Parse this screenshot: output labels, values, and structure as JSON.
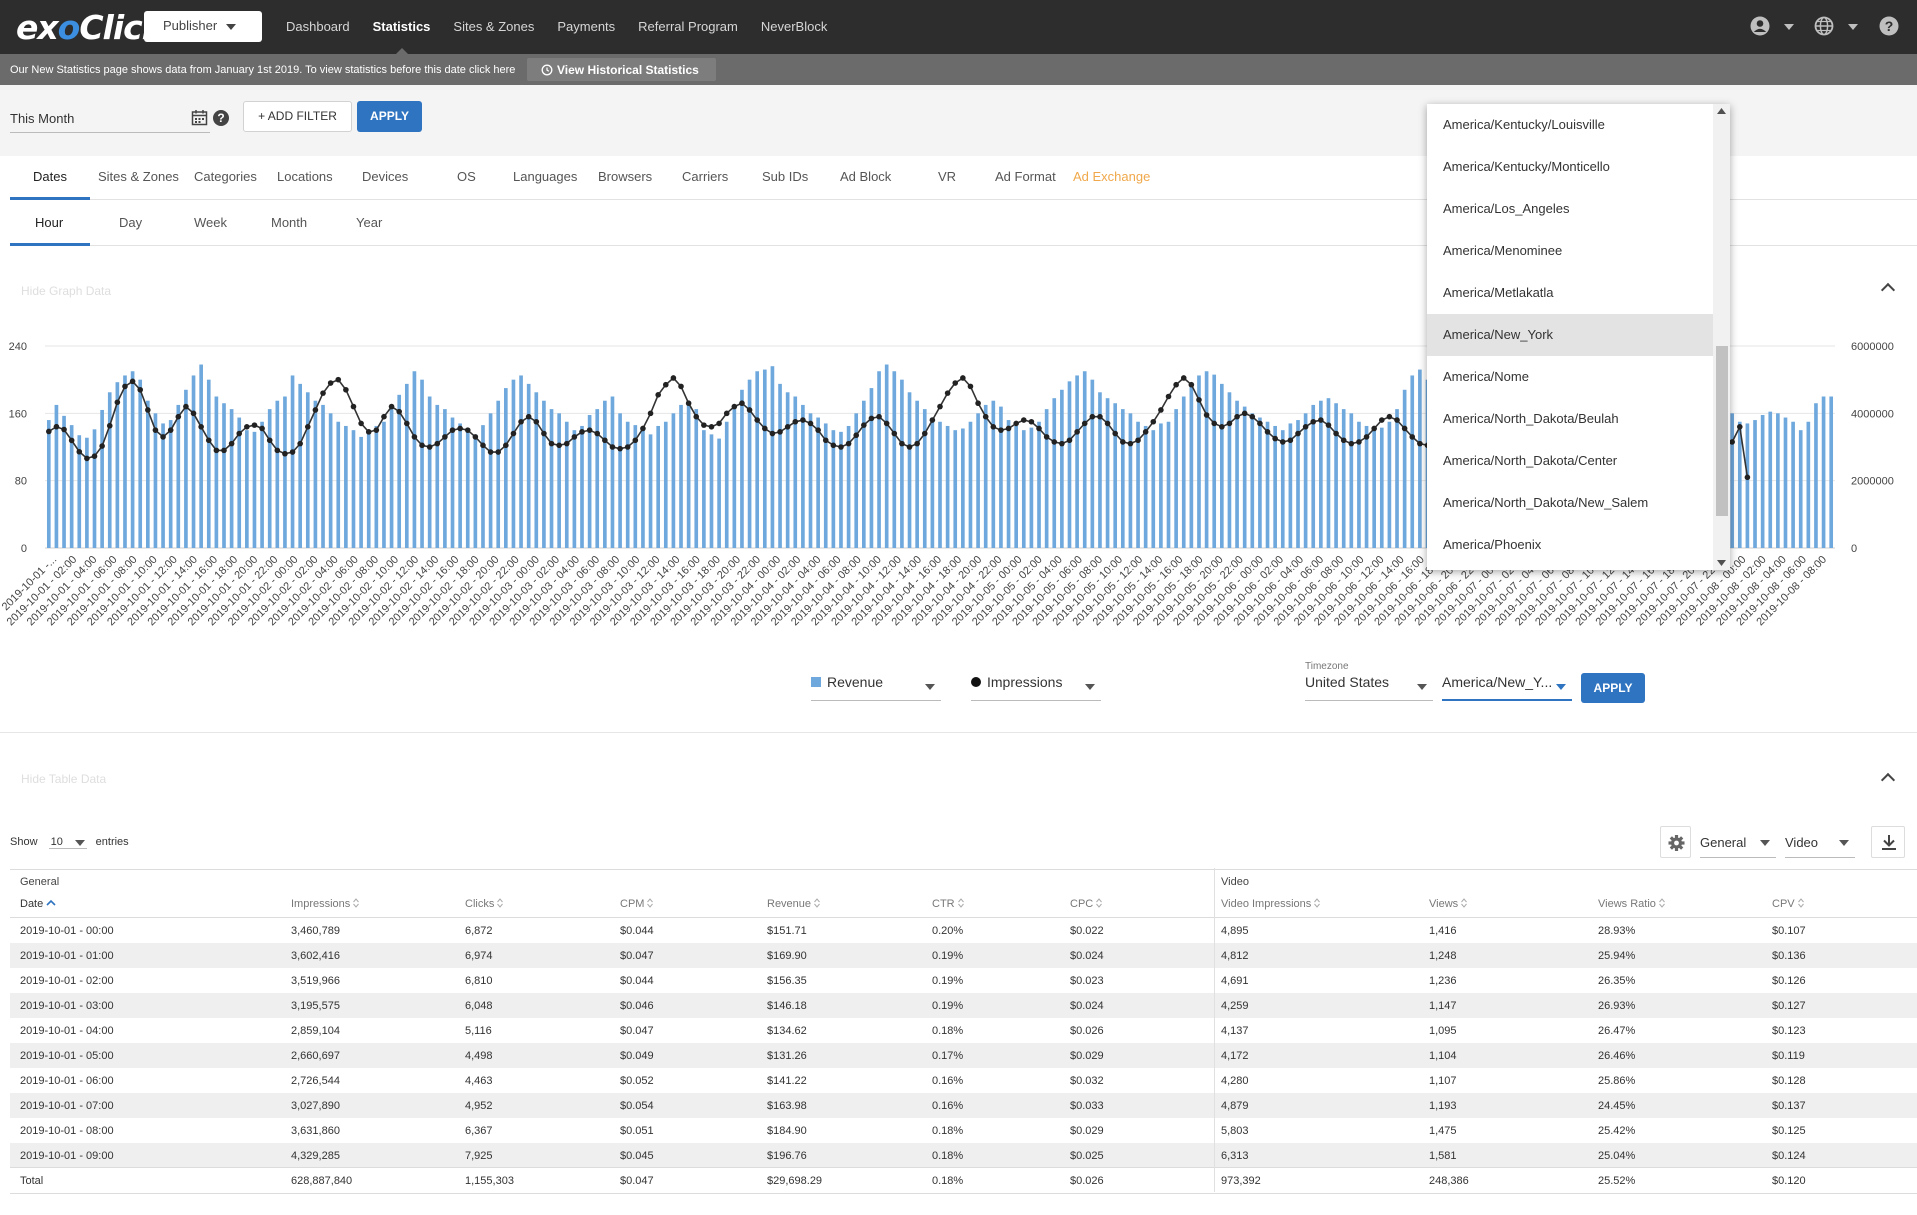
{
  "brand": {
    "logo_text_ex": "ex",
    "logo_text_o": "o",
    "logo_text_rest": "Click",
    "accent": "#2f74c0",
    "bar_color": "#6fa8dc"
  },
  "header": {
    "role_select": "Publisher",
    "nav": [
      "Dashboard",
      "Statistics",
      "Sites & Zones",
      "Payments",
      "Referral Program",
      "NeverBlock"
    ],
    "active_nav": "Statistics",
    "icons": [
      "account-icon",
      "globe-icon",
      "help-icon"
    ]
  },
  "notice": {
    "text": "Our New Statistics page shows data from January 1st 2019. To view statistics before this date click here",
    "button": "View Historical Statistics"
  },
  "filters": {
    "date_range": "This Month",
    "add_filter": "+ ADD FILTER",
    "apply": "APPLY"
  },
  "tabs": [
    "Dates",
    "Sites & Zones",
    "Categories",
    "Locations",
    "Devices",
    "OS",
    "Languages",
    "Browsers",
    "Carriers",
    "Sub IDs",
    "Ad Block",
    "VR",
    "Ad Format",
    "Ad Exchange"
  ],
  "active_tab": "Dates",
  "subtabs": [
    "Hour",
    "Day",
    "Week",
    "Month",
    "Year"
  ],
  "active_subtab": "Hour",
  "graph_toggle": "Hide Graph Data",
  "table_toggle": "Hide Table Data",
  "graph_controls": {
    "metric_left": "Revenue",
    "metric_right": "Impressions",
    "timezone_label": "Timezone",
    "country": "United States",
    "timezone": "America/New_Y...",
    "apply": "APPLY"
  },
  "timezone_dropdown": {
    "options": [
      "America/Kentucky/Louisville",
      "America/Kentucky/Monticello",
      "America/Los_Angeles",
      "America/Menominee",
      "America/Metlakatla",
      "America/New_York",
      "America/Nome",
      "America/North_Dakota/Beulah",
      "America/North_Dakota/Center",
      "America/North_Dakota/New_Salem",
      "America/Phoenix"
    ],
    "selected": "America/New_York"
  },
  "chart_data": {
    "type": "bar",
    "title": "",
    "y_left_ticks": [
      "240",
      "160",
      "80",
      "0"
    ],
    "y_right_ticks": [
      "6000000",
      "4000000",
      "2000000",
      "0"
    ],
    "ylim_left": [
      0,
      240
    ],
    "ylim_right": [
      0,
      6000000
    ],
    "x_tick_labels": [
      "2019-10-01 -...",
      "2019-10-01 - 02:00",
      "2019-10-01 - 04:00",
      "2019-10-01 - 06:00",
      "2019-10-01 - 08:00",
      "2019-10-01 - 10:00",
      "2019-10-01 - 12:00",
      "2019-10-01 - 14:00",
      "2019-10-01 - 16:00",
      "2019-10-01 - 18:00",
      "2019-10-01 - 20:00",
      "2019-10-01 - 22:00",
      "2019-10-02 - 00:00",
      "2019-10-02 - 02:00",
      "2019-10-02 - 04:00",
      "2019-10-02 - 06:00",
      "2019-10-02 - 08:00",
      "2019-10-02 - 10:00",
      "2019-10-02 - 12:00",
      "2019-10-02 - 14:00",
      "2019-10-02 - 16:00",
      "2019-10-02 - 18:00",
      "2019-10-02 - 20:00",
      "2019-10-02 - 22:00",
      "2019-10-03 - 00:00",
      "2019-10-03 - 02:00",
      "2019-10-03 - 04:00",
      "2019-10-03 - 06:00",
      "2019-10-03 - 08:00",
      "2019-10-03 - 10:00",
      "2019-10-03 - 12:00",
      "2019-10-03 - 14:00",
      "2019-10-03 - 16:00",
      "2019-10-03 - 18:00",
      "2019-10-03 - 20:00",
      "2019-10-03 - 22:00",
      "2019-10-04 - 00:00",
      "2019-10-04 - 02:00",
      "2019-10-04 - 04:00",
      "2019-10-04 - 06:00",
      "2019-10-04 - 08:00",
      "2019-10-04 - 10:00",
      "2019-10-04 - 12:00",
      "2019-10-04 - 14:00",
      "2019-10-04 - 16:00",
      "2019-10-04 - 18:00",
      "2019-10-04 - 20:00",
      "2019-10-04 - 22:00",
      "2019-10-05 - 00:00",
      "2019-10-05 - 02:00",
      "2019-10-05 - 04:00",
      "2019-10-05 - 06:00",
      "2019-10-05 - 08:00",
      "2019-10-05 - 10:00",
      "2019-10-05 - 12:00",
      "2019-10-05 - 14:00",
      "2019-10-05 - 16:00",
      "2019-10-05 - 18:00",
      "2019-10-05 - 20:00",
      "2019-10-05 - 22:00",
      "2019-10-06 - 00:00",
      "2019-10-06 - 02:00",
      "2019-10-06 - 04:00",
      "2019-10-06 - 06:00",
      "2019-10-06 - 08:00",
      "2019-10-06 - 10:00",
      "2019-10-06 - 12:00",
      "2019-10-06 - 14:00",
      "2019-10-06 - 16:00",
      "2019-10-06 - 18:00",
      "2019-10-06 - 20:00",
      "2019-10-06 - 22:00",
      "2019-10-07 - 00:00",
      "2019-10-07 - 02:00",
      "2019-10-07 - 04:00",
      "2019-10-07 - 06:00",
      "2019-10-07 - 08:00",
      "2019-10-07 - 10:00",
      "2019-10-07 - 12:00",
      "2019-10-07 - 14:00",
      "2019-10-07 - 16:00",
      "2019-10-07 - 18:00",
      "2019-10-07 - 20:00",
      "2019-10-07 - 22:00",
      "2019-10-08 - 00:00",
      "2019-10-08 - 02:00",
      "2019-10-08 - 04:00",
      "2019-10-08 - 06:00",
      "2019-10-08 - 08:00"
    ],
    "series": [
      {
        "name": "Revenue",
        "kind": "bar",
        "axis": "left",
        "color": "#6fa8dc",
        "values": [
          152,
          170,
          157,
          146,
          134,
          131,
          141,
          164,
          185,
          197,
          205,
          210,
          200,
          175,
          160,
          148,
          152,
          170,
          188,
          205,
          218,
          200,
          180,
          172,
          165,
          155,
          140,
          138,
          150,
          165,
          175,
          180,
          205,
          195,
          185,
          175,
          170,
          160,
          150,
          145,
          140,
          132,
          138,
          145,
          150,
          165,
          182,
          195,
          210,
          200,
          180,
          170,
          165,
          155,
          148,
          140,
          135,
          146,
          160,
          175,
          190,
          200,
          205,
          195,
          185,
          175,
          165,
          160,
          150,
          140,
          145,
          158,
          165,
          175,
          180,
          160,
          150,
          146,
          140,
          135,
          145,
          150,
          160,
          170,
          172,
          165,
          140,
          135,
          130,
          150,
          165,
          188,
          200,
          210,
          212,
          216,
          195,
          185,
          180,
          170,
          160,
          155,
          148,
          140,
          138,
          145,
          160,
          175,
          190,
          210,
          218,
          210,
          200,
          185,
          175,
          165,
          155,
          150,
          145,
          140,
          142,
          150,
          160,
          170,
          175,
          168,
          152,
          145,
          140,
          143,
          150,
          165,
          178,
          188,
          198,
          205,
          210,
          200,
          185,
          178,
          172,
          165,
          160,
          150,
          145,
          140,
          148,
          150,
          165,
          180,
          195,
          205,
          210,
          206,
          195,
          185,
          175,
          168,
          160,
          155,
          150,
          145,
          140,
          148,
          152,
          160,
          170,
          175,
          178,
          172,
          165,
          160,
          150,
          145,
          140,
          143,
          150,
          165,
          188,
          205,
          212,
          200,
          190,
          185,
          182,
          180,
          172,
          165,
          160,
          155,
          150,
          145,
          160,
          170,
          172,
          178,
          182,
          176,
          165,
          160,
          155,
          152,
          150,
          152,
          155,
          160,
          165,
          170,
          172,
          150,
          145,
          142,
          145,
          150,
          160,
          168,
          172,
          175,
          182,
          178,
          170,
          160,
          150,
          148,
          152,
          158,
          162,
          160,
          155,
          150,
          140,
          150,
          172,
          180,
          180
        ]
      },
      {
        "name": "Impressions",
        "kind": "line",
        "axis": "right",
        "color": "#333333",
        "values": [
          3460789,
          3602416,
          3519966,
          3195575,
          2859104,
          2660697,
          2726544,
          3027890,
          3631860,
          4329285,
          4800000,
          4950000,
          4700000,
          4100000,
          3500000,
          3300000,
          3500000,
          3900000,
          4200000,
          4000000,
          3600000,
          3200000,
          2900000,
          2900000,
          3100000,
          3400000,
          3600000,
          3650000,
          3550000,
          3200000,
          2900000,
          2800000,
          2850000,
          3100000,
          3600000,
          4100000,
          4600000,
          4900000,
          5000000,
          4700000,
          4200000,
          3700000,
          3450000,
          3500000,
          3900000,
          4200000,
          4050000,
          3700000,
          3300000,
          3050000,
          3000000,
          3100000,
          3300000,
          3500000,
          3550000,
          3500000,
          3300000,
          3050000,
          2850000,
          2850000,
          3050000,
          3400000,
          3750000,
          3900000,
          3750000,
          3400000,
          3100000,
          3050000,
          3100000,
          3300000,
          3450000,
          3500000,
          3400000,
          3200000,
          3000000,
          2950000,
          3000000,
          3200000,
          3550000,
          4000000,
          4550000,
          4850000,
          5050000,
          4800000,
          4300000,
          3900000,
          3650000,
          3600000,
          3700000,
          4000000,
          4200000,
          4300000,
          4100000,
          3800000,
          3550000,
          3400000,
          3450000,
          3600000,
          3750000,
          3800000,
          3700000,
          3500000,
          3200000,
          3050000,
          3000000,
          3100000,
          3350000,
          3650000,
          3850000,
          3900000,
          3700000,
          3400000,
          3100000,
          3000000,
          3100000,
          3400000,
          3800000,
          4200000,
          4600000,
          4900000,
          5050000,
          4800000,
          4300000,
          3900000,
          3600000,
          3500000,
          3550000,
          3700000,
          3800000,
          3750000,
          3550000,
          3300000,
          3150000,
          3100000,
          3200000,
          3450000,
          3700000,
          3900000,
          3900000,
          3700000,
          3400000,
          3150000,
          3100000,
          3200000,
          3450000,
          3750000,
          4100000,
          4500000,
          4850000,
          5050000,
          4850000,
          4400000,
          3950000,
          3700000,
          3600000,
          3700000,
          3900000,
          4000000,
          3900000,
          3700000,
          3450000,
          3250000,
          3150000,
          3200000,
          3400000,
          3600000,
          3750000,
          3800000,
          3650000,
          3400000,
          3200000,
          3100000,
          3150000,
          3300000,
          3550000,
          3800000,
          3900000,
          3800000,
          3550000,
          3300000,
          3100000,
          3050000,
          3100000,
          3300000,
          3500000,
          3600000,
          3550000,
          3450000,
          3350000,
          3300000,
          3300000,
          3350000,
          3400000,
          3450000,
          3500000,
          3500000,
          3480000,
          3460000,
          3440000,
          3420000,
          3450000,
          3500000,
          3550000,
          3600000,
          3600000,
          3550000,
          3500000,
          3400000,
          3300000,
          3200000,
          3150000,
          3200000,
          3300000,
          3450000,
          3600000,
          3700000,
          3600000,
          3400000,
          3150000,
          3000000,
          3000000,
          3150000,
          3600000,
          2100000
        ]
      }
    ]
  },
  "table": {
    "show_label": "Show",
    "entries_value": "10",
    "entries_label": "entries",
    "column_group_1": "General",
    "column_group_2": "Video",
    "general_select": "General",
    "video_select": "Video",
    "headers": [
      "Date",
      "Impressions",
      "Clicks",
      "CPM",
      "Revenue",
      "CTR",
      "CPC",
      "Video Impressions",
      "Views",
      "Views Ratio",
      "CPV"
    ],
    "rows": [
      [
        "2019-10-01 - 00:00",
        "3,460,789",
        "6,872",
        "$0.044",
        "$151.71",
        "0.20%",
        "$0.022",
        "4,895",
        "1,416",
        "28.93%",
        "$0.107"
      ],
      [
        "2019-10-01 - 01:00",
        "3,602,416",
        "6,974",
        "$0.047",
        "$169.90",
        "0.19%",
        "$0.024",
        "4,812",
        "1,248",
        "25.94%",
        "$0.136"
      ],
      [
        "2019-10-01 - 02:00",
        "3,519,966",
        "6,810",
        "$0.044",
        "$156.35",
        "0.19%",
        "$0.023",
        "4,691",
        "1,236",
        "26.35%",
        "$0.126"
      ],
      [
        "2019-10-01 - 03:00",
        "3,195,575",
        "6,048",
        "$0.046",
        "$146.18",
        "0.19%",
        "$0.024",
        "4,259",
        "1,147",
        "26.93%",
        "$0.127"
      ],
      [
        "2019-10-01 - 04:00",
        "2,859,104",
        "5,116",
        "$0.047",
        "$134.62",
        "0.18%",
        "$0.026",
        "4,137",
        "1,095",
        "26.47%",
        "$0.123"
      ],
      [
        "2019-10-01 - 05:00",
        "2,660,697",
        "4,498",
        "$0.049",
        "$131.26",
        "0.17%",
        "$0.029",
        "4,172",
        "1,104",
        "26.46%",
        "$0.119"
      ],
      [
        "2019-10-01 - 06:00",
        "2,726,544",
        "4,463",
        "$0.052",
        "$141.22",
        "0.16%",
        "$0.032",
        "4,280",
        "1,107",
        "25.86%",
        "$0.128"
      ],
      [
        "2019-10-01 - 07:00",
        "3,027,890",
        "4,952",
        "$0.054",
        "$163.98",
        "0.16%",
        "$0.033",
        "4,879",
        "1,193",
        "24.45%",
        "$0.137"
      ],
      [
        "2019-10-01 - 08:00",
        "3,631,860",
        "6,367",
        "$0.051",
        "$184.90",
        "0.18%",
        "$0.029",
        "5,803",
        "1,475",
        "25.42%",
        "$0.125"
      ],
      [
        "2019-10-01 - 09:00",
        "4,329,285",
        "7,925",
        "$0.045",
        "$196.76",
        "0.18%",
        "$0.025",
        "6,313",
        "1,581",
        "25.04%",
        "$0.124"
      ]
    ],
    "total": [
      "Total",
      "628,887,840",
      "1,155,303",
      "$0.047",
      "$29,698.29",
      "0.18%",
      "$0.026",
      "973,392",
      "248,386",
      "25.52%",
      "$0.120"
    ]
  }
}
